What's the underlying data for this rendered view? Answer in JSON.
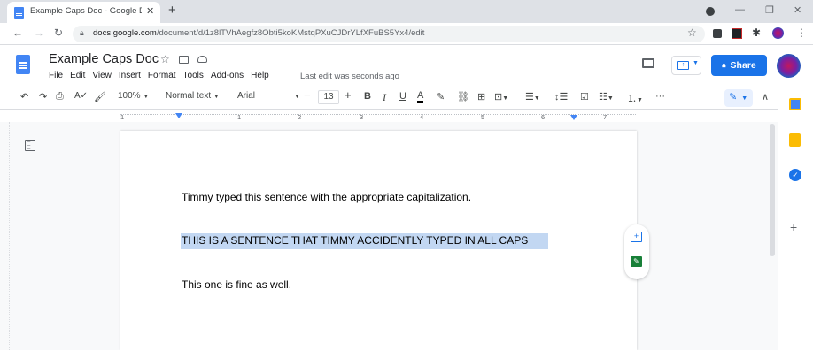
{
  "browser": {
    "tab_title": "Example Caps Doc - Google Docs",
    "url_host": "docs.google.com",
    "url_path": "/document/d/1z8lTVhAegfz8Obti5koKMstqPXuCJDrYLfXFuBS5Yx4/edit"
  },
  "docs": {
    "title": "Example Caps Doc",
    "menu": [
      "File",
      "Edit",
      "View",
      "Insert",
      "Format",
      "Tools",
      "Add-ons",
      "Help"
    ],
    "last_edit": "Last edit was seconds ago",
    "share_label": "Share"
  },
  "toolbar": {
    "zoom": "100%",
    "style": "Normal text",
    "font": "Arial",
    "font_size": "13",
    "more": "···"
  },
  "ruler": {
    "marks": [
      "1",
      "1",
      "2",
      "3",
      "4",
      "5",
      "6",
      "7"
    ]
  },
  "document": {
    "lines": [
      "Timmy typed this sentence with the appropriate capitalization.",
      "THIS IS A SENTENCE THAT TIMMY ACCIDENTLY TYPED IN ALL CAPS",
      "This one is fine as well."
    ]
  },
  "colors": {
    "accent": "#1a73e8",
    "selection": "#c2d7f2",
    "docs_blue": "#4285f4"
  }
}
